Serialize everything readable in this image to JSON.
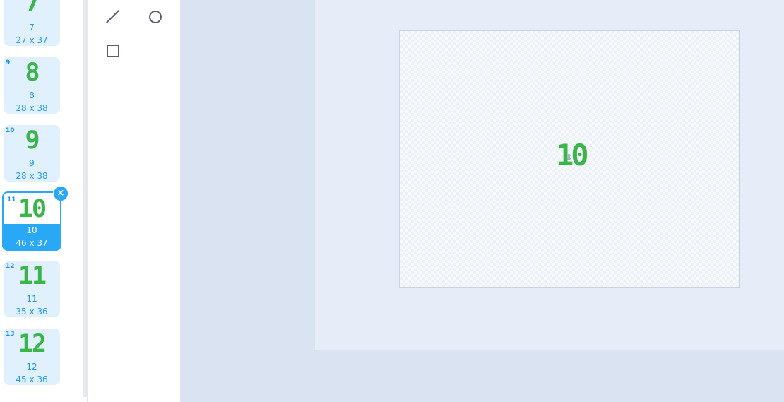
{
  "costumes": [
    {
      "number": "",
      "glyph": "7",
      "name": "7",
      "size": "27 x 37"
    },
    {
      "number": "9",
      "glyph": "8",
      "name": "8",
      "size": "28 x 38"
    },
    {
      "number": "10",
      "glyph": "9",
      "name": "9",
      "size": "28 x 38"
    },
    {
      "number": "11",
      "glyph": "10",
      "name": "10",
      "size": "46 x 37",
      "selected": true
    },
    {
      "number": "12",
      "glyph": "11",
      "name": "11",
      "size": "35 x 36"
    },
    {
      "number": "13",
      "glyph": "12",
      "name": "12",
      "size": "45 x 36"
    }
  ],
  "delete_icon": "×",
  "tools": [
    {
      "name": "line-tool",
      "icon": "line-icon"
    },
    {
      "name": "circle-tool",
      "icon": "circle-icon"
    },
    {
      "name": "rectangle-tool",
      "icon": "rectangle-icon"
    }
  ],
  "canvas": {
    "costume_text": "10",
    "center_icon": "⇕"
  },
  "colors": {
    "accent": "#29a8f5",
    "costume_green": "#3ab54a",
    "canvas_bg": "#dae3f1"
  }
}
